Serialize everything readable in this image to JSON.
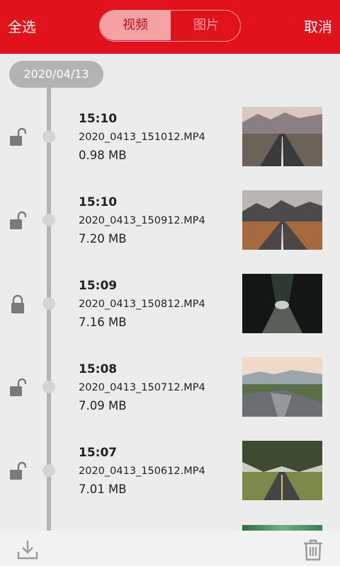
{
  "header": {
    "select_all": "全选",
    "cancel": "取消",
    "tabs": [
      {
        "label": "视频",
        "active": true
      },
      {
        "label": "图片",
        "active": false
      }
    ]
  },
  "timeline": {
    "date": "2020/04/13"
  },
  "items": [
    {
      "time": "15:10",
      "filename": "2020_0413_151012.MP4",
      "size": "0.98 MB",
      "locked": false
    },
    {
      "time": "15:10",
      "filename": "2020_0413_150912.MP4",
      "size": "7.20 MB",
      "locked": false
    },
    {
      "time": "15:09",
      "filename": "2020_0413_150812.MP4",
      "size": "7.16 MB",
      "locked": true
    },
    {
      "time": "15:08",
      "filename": "2020_0413_150712.MP4",
      "size": "7.09 MB",
      "locked": false
    },
    {
      "time": "15:07",
      "filename": "2020_0413_150612.MP4",
      "size": "7.01 MB",
      "locked": false
    }
  ],
  "icons": {
    "download": "download-icon",
    "delete": "trash-icon",
    "lock_open": "lock-open-icon",
    "lock_closed": "lock-closed-icon"
  },
  "colors": {
    "header_red": "#e0121b",
    "timeline_gray": "#b3b3b3",
    "tab_active_bg": "#f3a1a4"
  }
}
